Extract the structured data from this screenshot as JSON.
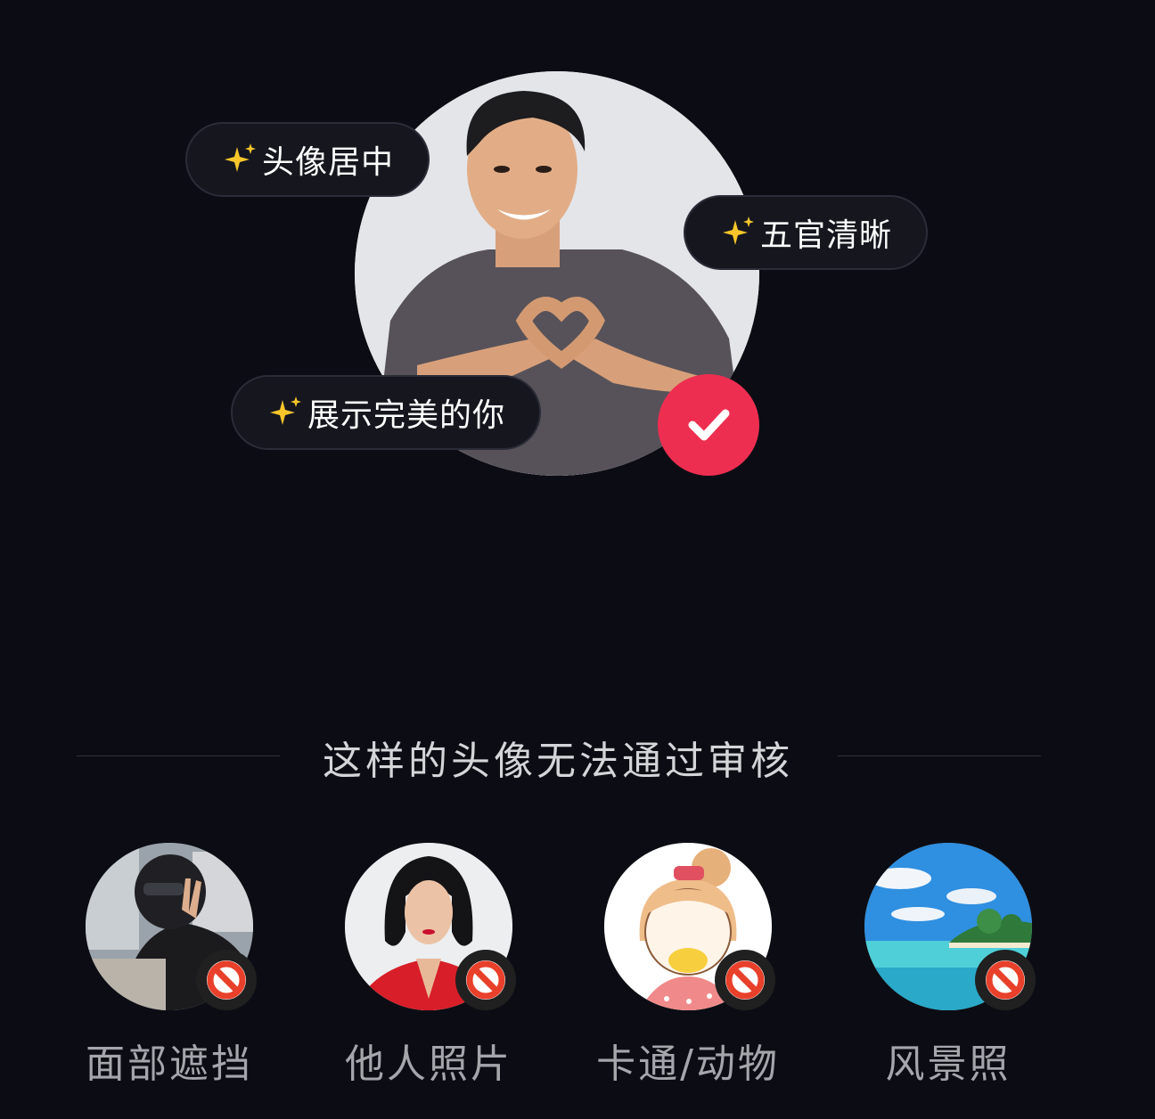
{
  "tags": {
    "centered": "头像居中",
    "clear_features": "五官清晰",
    "show_perfect": "展示完美的你"
  },
  "section_title": "这样的头像无法通过审核",
  "rejected_examples": [
    {
      "label": "面部遮挡"
    },
    {
      "label": "他人照片"
    },
    {
      "label": "卡通/动物"
    },
    {
      "label": "风景照"
    }
  ],
  "colors": {
    "background": "#0c0d14",
    "check_badge": "#ee2e51",
    "pill_background": "#15161e",
    "ban_red": "#e8402a",
    "sparkle": "#f8c62a"
  },
  "icons": {
    "sparkle": "sparkle-icon",
    "check": "check-icon",
    "ban": "ban-icon"
  }
}
